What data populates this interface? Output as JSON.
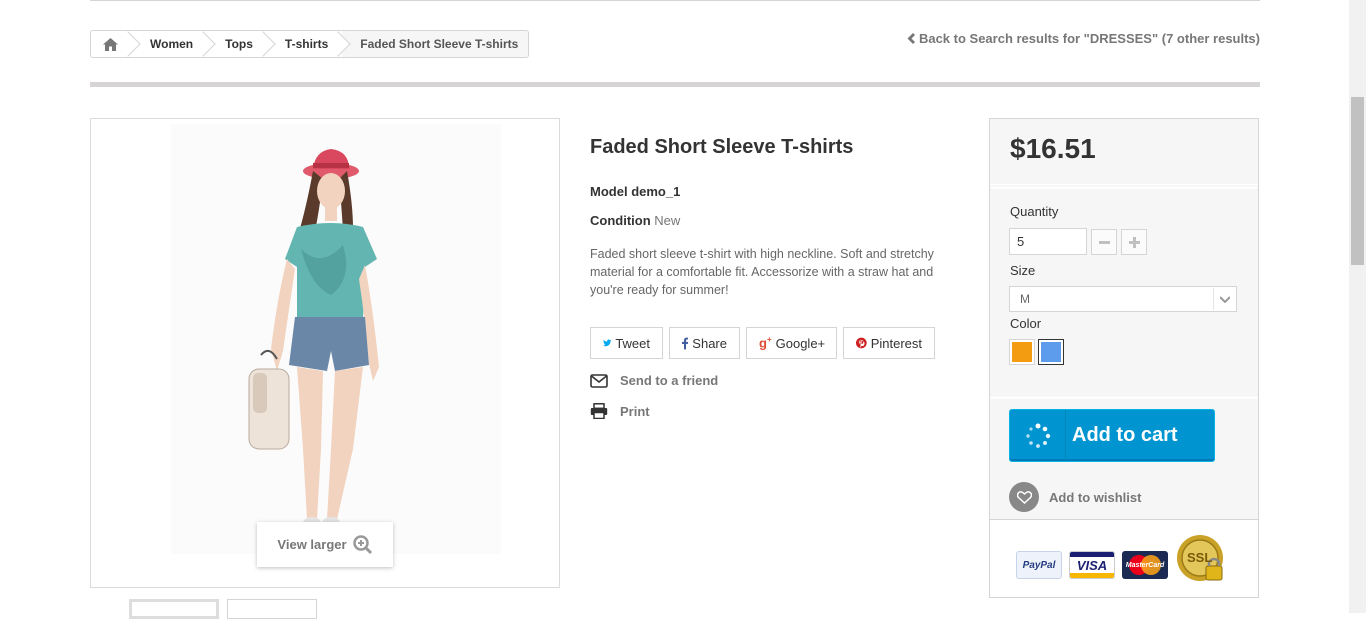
{
  "breadcrumb": {
    "items": [
      "Women",
      "Tops",
      "T-shirts"
    ],
    "current": "Faded Short Sleeve T-shirts"
  },
  "back_link": "Back to Search results for \"DRESSES\" (7 other results)",
  "product": {
    "title": "Faded Short Sleeve T-shirts",
    "model_label": "Model",
    "model_value": "demo_1",
    "condition_label": "Condition",
    "condition_value": "New",
    "description": "Faded short sleeve t-shirt with high neckline. Soft and stretchy material for a comfortable fit. Accessorize with a straw hat and you're ready for summer!",
    "view_larger": "View larger"
  },
  "social": {
    "tweet": "Tweet",
    "share": "Share",
    "google": "Google+",
    "pinterest": "Pinterest"
  },
  "actions": {
    "send_friend": "Send to a friend",
    "print": "Print"
  },
  "buy": {
    "price": "$16.51",
    "quantity_label": "Quantity",
    "quantity_value": "5",
    "size_label": "Size",
    "size_value": "M",
    "color_label": "Color",
    "colors": [
      "#f39c11",
      "#5d9cec"
    ],
    "add_to_cart": "Add to cart",
    "add_wishlist": "Add to wishlist"
  },
  "payment_logos": {
    "paypal": "PayPal",
    "visa": "VISA",
    "mastercard": "MasterCard",
    "ssl": "SSL"
  }
}
